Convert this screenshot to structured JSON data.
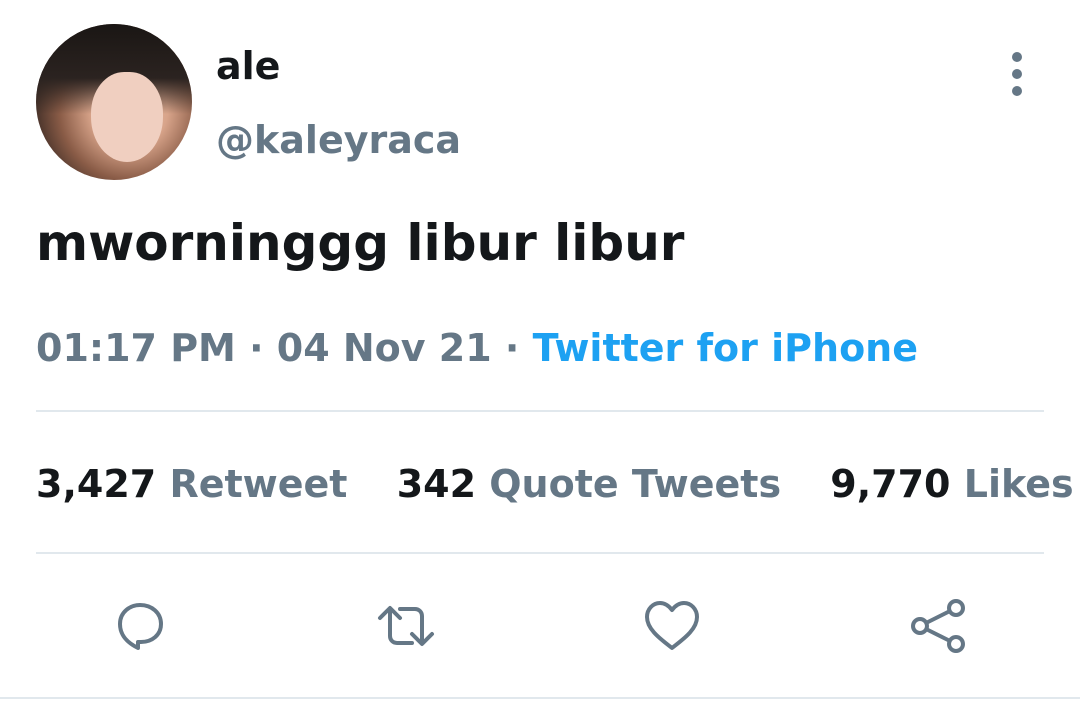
{
  "tweet": {
    "author": {
      "name": "ale",
      "handle": "@kaleyraca"
    },
    "text": "mworninggg libur libur",
    "time": "01:17 PM",
    "separator1": "·",
    "date": "04 Nov 21",
    "separator2": "·",
    "source": "Twitter for iPhone"
  },
  "stats": {
    "retweets": {
      "count": "3,427",
      "label": "Retweet"
    },
    "quotes": {
      "count": "342",
      "label": "Quote Tweets"
    },
    "likes": {
      "count": "9,770",
      "label": "Likes"
    }
  },
  "icons": {
    "more": "more-vertical-icon",
    "reply": "reply-icon",
    "retweet": "retweet-icon",
    "like": "heart-icon",
    "share": "share-icon"
  },
  "colors": {
    "text": "#14171a",
    "secondary": "#657786",
    "link": "#1da1f2",
    "divider": "#e1e8ed"
  }
}
